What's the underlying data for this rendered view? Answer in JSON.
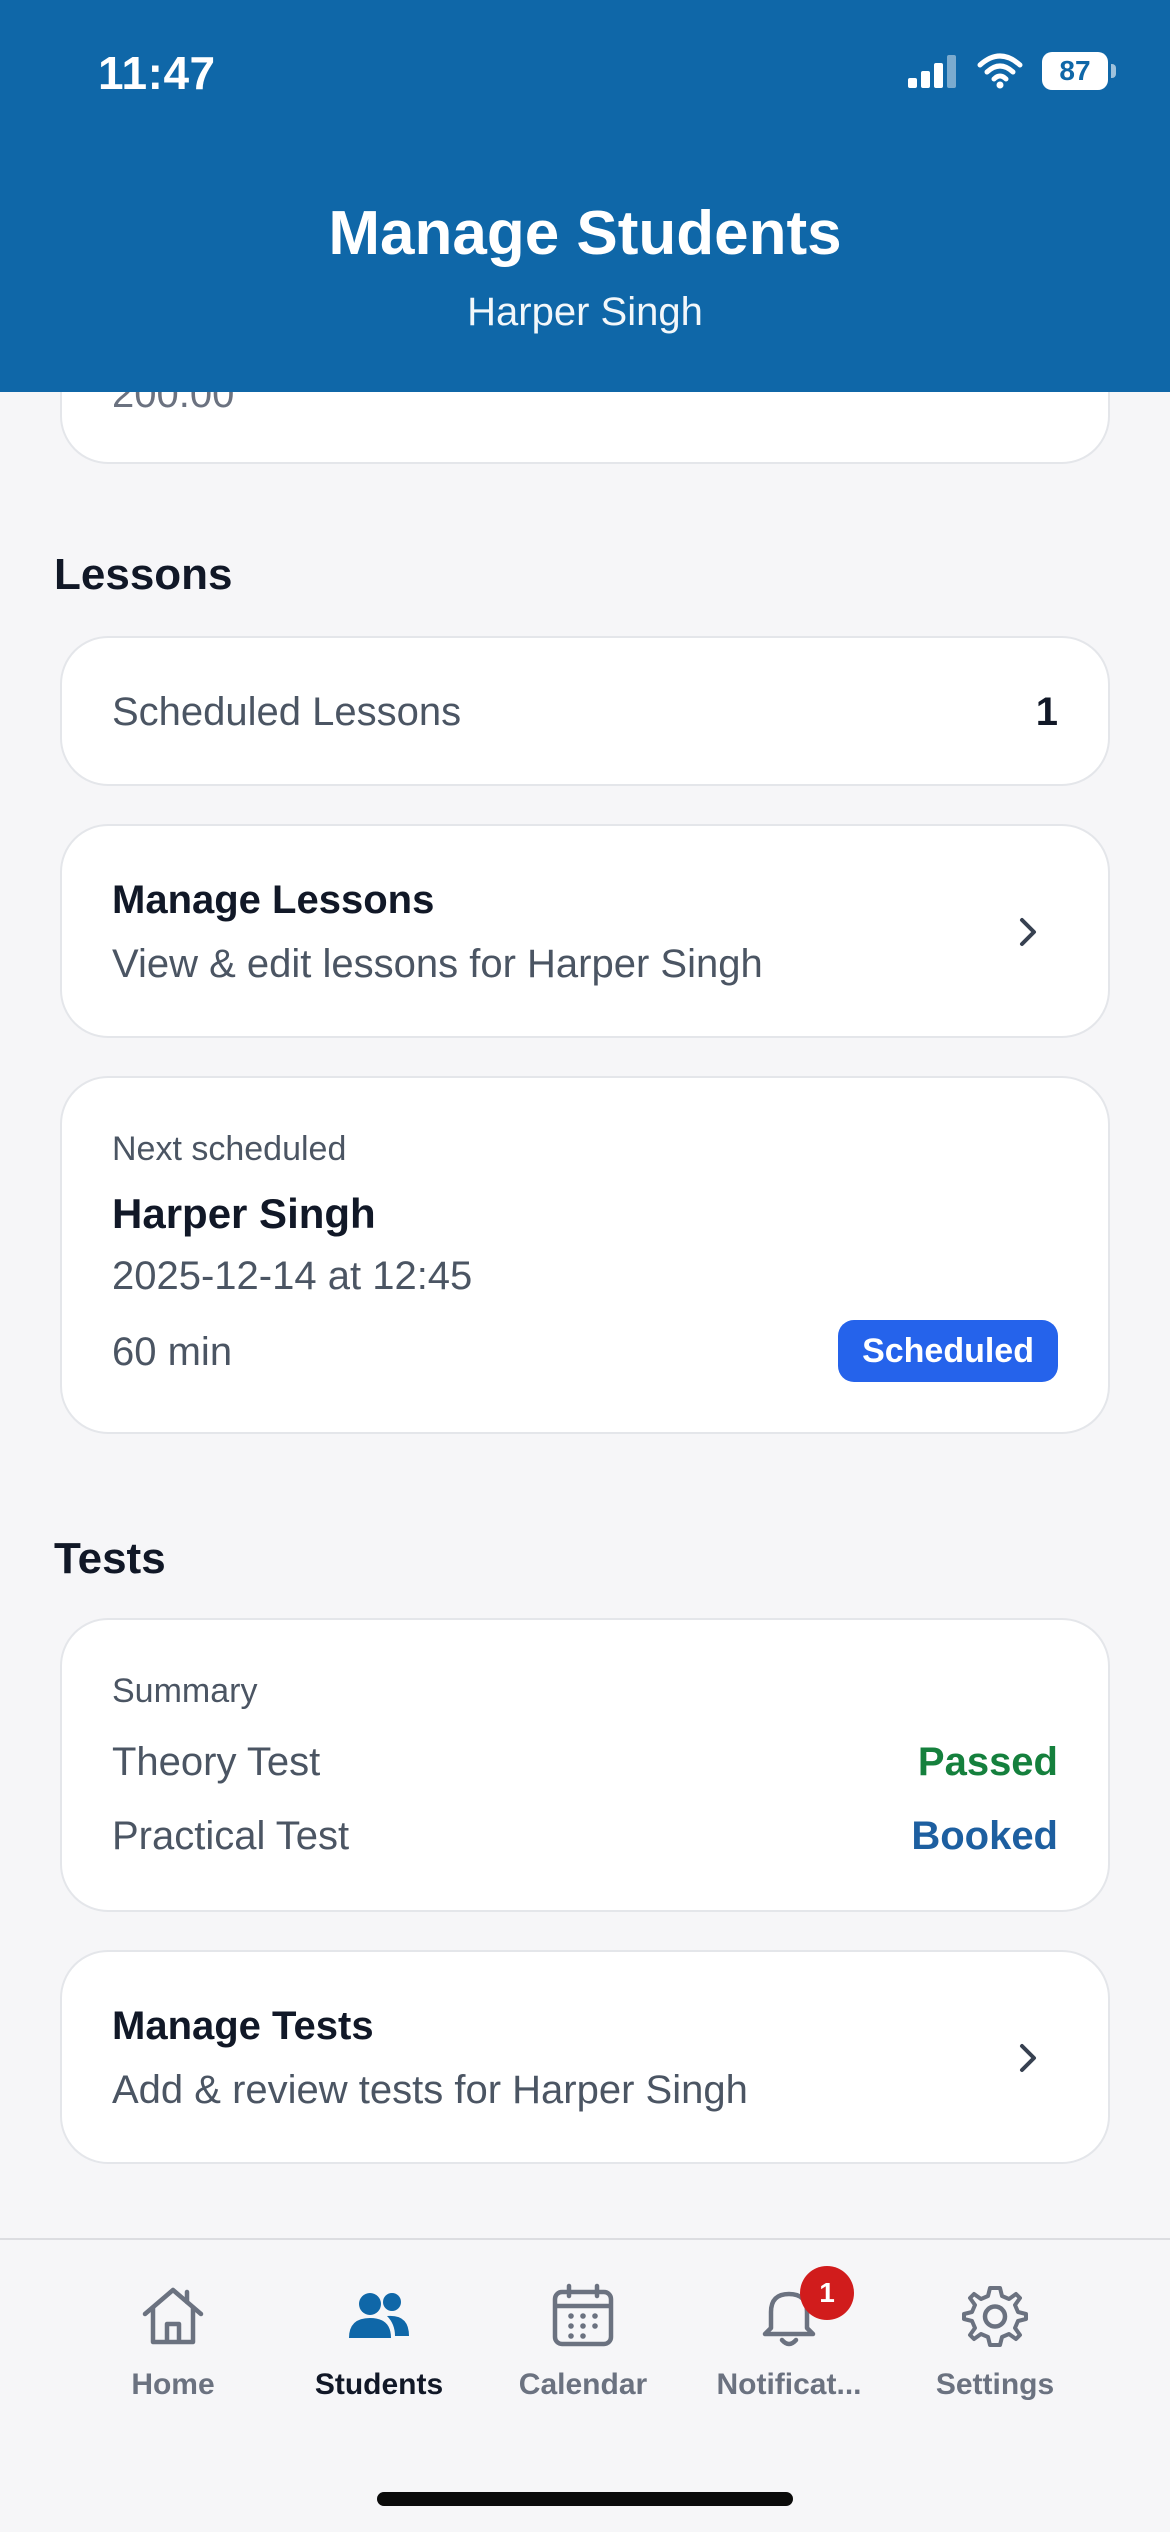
{
  "status": {
    "time": "11:47",
    "battery": "87"
  },
  "header": {
    "title": "Manage Students",
    "subtitle": "Harper Singh"
  },
  "top_card": {
    "partial_value": "200.00"
  },
  "lessons": {
    "section_title": "Lessons",
    "scheduled": {
      "label": "Scheduled Lessons",
      "value": "1"
    },
    "manage": {
      "title": "Manage Lessons",
      "subtitle": "View & edit lessons for Harper Singh"
    },
    "next": {
      "label": "Next scheduled",
      "name": "Harper Singh",
      "datetime": "2025-12-14 at 12:45",
      "duration": "60 min",
      "status": "Scheduled"
    }
  },
  "tests": {
    "section_title": "Tests",
    "summary": {
      "label": "Summary",
      "theory": {
        "label": "Theory Test",
        "value": "Passed"
      },
      "practical": {
        "label": "Practical Test",
        "value": "Booked"
      }
    },
    "manage": {
      "title": "Manage Tests",
      "subtitle": "Add & review tests for Harper Singh"
    }
  },
  "tabbar": {
    "items": [
      {
        "label": "Home",
        "icon": "home-icon"
      },
      {
        "label": "Students",
        "icon": "students-icon"
      },
      {
        "label": "Calendar",
        "icon": "calendar-icon"
      },
      {
        "label": "Notificat...",
        "icon": "bell-icon",
        "badge": "1"
      },
      {
        "label": "Settings",
        "icon": "gear-icon"
      }
    ]
  },
  "colors": {
    "header_bg": "#0f67a8",
    "badge_blue": "#2563eb",
    "passed_green": "#15803d",
    "booked_blue": "#1d5fa0",
    "notif_red": "#d11c1c"
  }
}
